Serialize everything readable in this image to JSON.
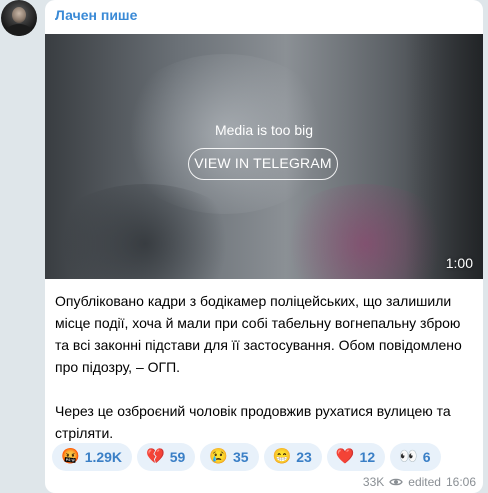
{
  "channel": {
    "name": "Лачен пише"
  },
  "media": {
    "message": "Media is too big",
    "button_label": "VIEW IN TELEGRAM",
    "duration": "1:00"
  },
  "post": {
    "paragraphs": [
      "Опубліковано кадри з бодікамер поліцейських, що залишили місце події, хоча й мали при собі табельну вогнепальну зброю та всі законні підстави для її застосування. Обом повідомлено про підозру, – ОГП.",
      "Через це озброєний чоловік продовжив рухатися вулицею та стріляти."
    ]
  },
  "reactions": [
    {
      "emoji": "🤬",
      "count": "1.29K"
    },
    {
      "emoji": "💔",
      "count": "59"
    },
    {
      "emoji": "😢",
      "count": "35"
    },
    {
      "emoji": "😁",
      "count": "23"
    },
    {
      "emoji": "❤️",
      "count": "12"
    },
    {
      "emoji": "👀",
      "count": "6"
    }
  ],
  "meta": {
    "views": "33K",
    "views_icon": "eye-icon",
    "edited_label": "edited",
    "time": "16:06"
  },
  "colors": {
    "accent": "#3a8ad6",
    "background": "#dfe6ea",
    "reaction_bg": "#e8f1fa"
  }
}
